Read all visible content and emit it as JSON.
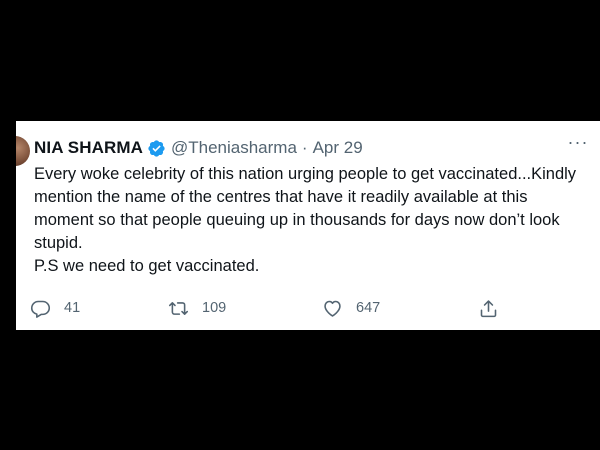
{
  "tweet": {
    "author_name": "NIA SHARMA",
    "handle": "@Theniasharma",
    "separator": "·",
    "date": "Apr 29",
    "more_label": "···",
    "text_lines": [
      "Every woke celebrity of this nation urging people to get vaccinated...Kindly mention the name of the centres that have it readily available at this moment so that people queuing up in thousands for days now don’t look stupid.",
      "P.S we need to get vaccinated."
    ],
    "reply_count": "41",
    "retweet_count": "109",
    "like_count": "647"
  },
  "icons": {
    "verified": "verified-badge-icon",
    "more": "more-options-icon",
    "reply": "reply-icon",
    "retweet": "retweet-icon",
    "like": "like-icon",
    "share": "share-icon"
  },
  "colors": {
    "verified_blue": "#1d9bf0",
    "text_primary": "#0f1419",
    "text_secondary": "#536471",
    "card_background": "#ffffff",
    "frame_background": "#000000"
  }
}
